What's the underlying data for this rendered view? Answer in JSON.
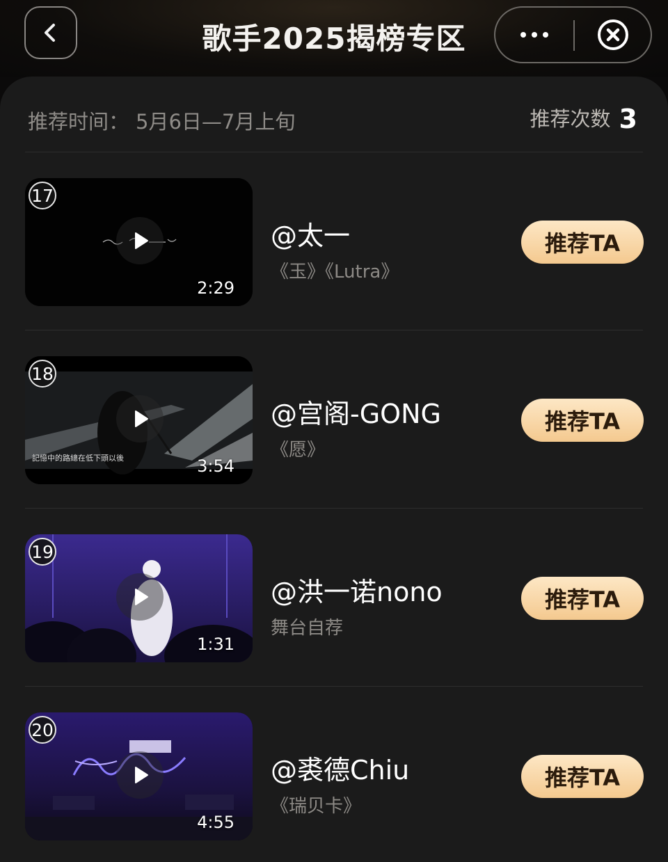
{
  "header": {
    "title": "歌手2025揭榜专区",
    "back_icon": "chevron-left-icon",
    "more_icon": "more-dots-icon",
    "close_icon": "close-circle-icon"
  },
  "info": {
    "time_label": "推荐时间",
    "time_colon": "：",
    "time_value": "5月6日—7月上旬",
    "count_label": "推荐次数",
    "count_value": "3"
  },
  "items": [
    {
      "rank": "17",
      "name": "@太一",
      "sub": "《玉》《Lutra》",
      "duration": "2:29",
      "button": "推荐TA",
      "caption": ""
    },
    {
      "rank": "18",
      "name": "@宫阁-GONG",
      "sub": "《愿》",
      "duration": "3:54",
      "button": "推荐TA",
      "caption": "記憶中的路總在低下頭以後"
    },
    {
      "rank": "19",
      "name": "@洪一诺nono",
      "sub": "舞台自荐",
      "duration": "1:31",
      "button": "推荐TA",
      "caption": ""
    },
    {
      "rank": "20",
      "name": "@裘德Chiu",
      "sub": "《瑞贝卡》",
      "duration": "4:55",
      "button": "推荐TA",
      "caption": ""
    }
  ],
  "colors": {
    "background": "#1b1b1b",
    "button_gradient_top": "#fde7c5",
    "button_gradient_bottom": "#f4c98f",
    "muted_text": "#8d8a86"
  }
}
